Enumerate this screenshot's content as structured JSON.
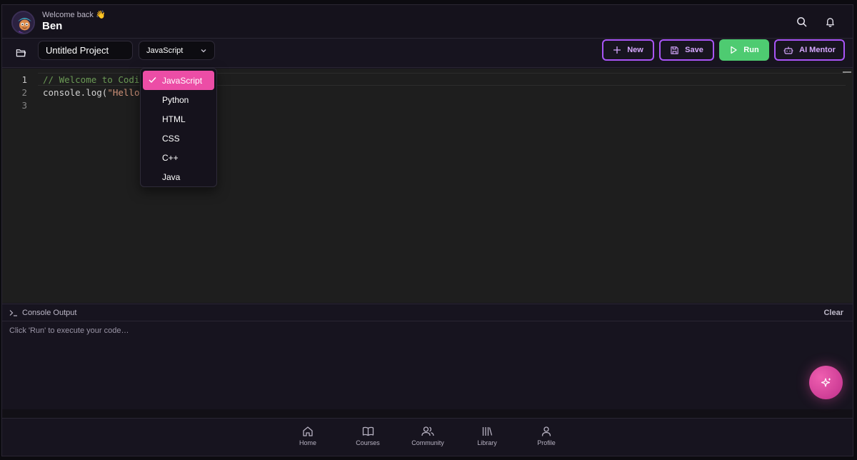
{
  "header": {
    "welcome": "Welcome back 👋",
    "username": "Ben",
    "icons": [
      "search-icon",
      "bell-icon"
    ]
  },
  "toolbar": {
    "project_name": "Untitled Project",
    "language_selected": "JavaScript",
    "new_label": "New",
    "save_label": "Save",
    "run_label": "Run",
    "ai_mentor_label": "AI Mentor"
  },
  "editor": {
    "line_numbers": [
      "1",
      "2",
      "3"
    ],
    "line1_comment": "// Welcome to Codin",
    "line2_prefix": "console.log(",
    "line2_string": "\"Hello,"
  },
  "dropdown": {
    "options": [
      "JavaScript",
      "Python",
      "HTML",
      "CSS",
      "C++",
      "Java"
    ],
    "selected": "JavaScript"
  },
  "console": {
    "title": "Console Output",
    "clear_label": "Clear",
    "placeholder": "Click 'Run' to execute your code…"
  },
  "nav": {
    "items": [
      {
        "label": "Home",
        "icon": "home-icon"
      },
      {
        "label": "Courses",
        "icon": "book-icon"
      },
      {
        "label": "Community",
        "icon": "users-icon"
      },
      {
        "label": "Library",
        "icon": "library-icon"
      },
      {
        "label": "Profile",
        "icon": "user-icon"
      }
    ]
  },
  "colors": {
    "accent_purple": "#a955f7",
    "accent_pink": "#ec4da6",
    "run_green": "#4ecb71",
    "background": "#17141f"
  }
}
